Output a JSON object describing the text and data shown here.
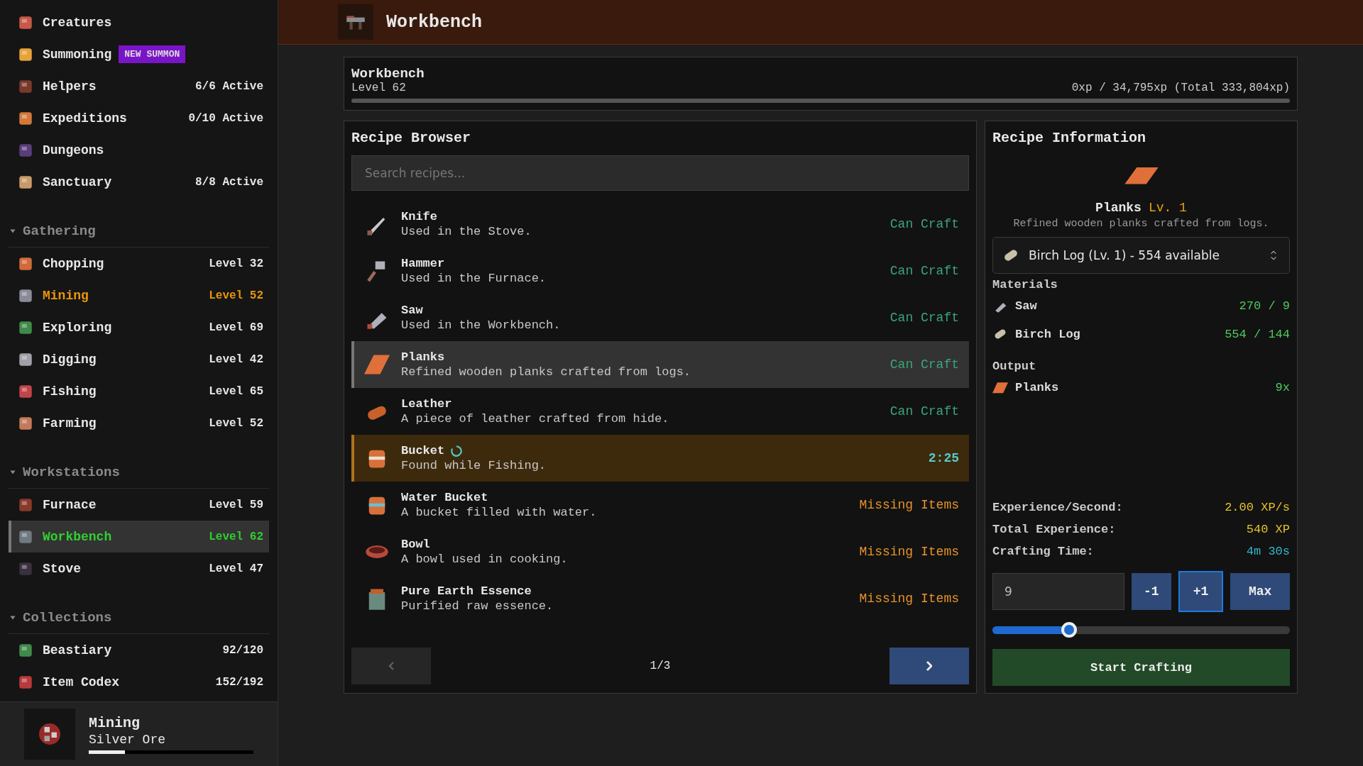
{
  "sidebar": {
    "top_items": [
      {
        "name": "Creatures"
      },
      {
        "name": "Summoning",
        "badge": "NEW SUMMON"
      },
      {
        "name": "Helpers",
        "status": "6/6 Active"
      },
      {
        "name": "Expeditions",
        "status": "0/10 Active"
      },
      {
        "name": "Dungeons"
      },
      {
        "name": "Sanctuary",
        "status": "8/8 Active"
      }
    ],
    "sections": [
      {
        "title": "Gathering",
        "expanded": true,
        "items": [
          {
            "name": "Chopping",
            "status": "Level 32",
            "active": false,
            "selected": false
          },
          {
            "name": "Mining",
            "status": "Level 52",
            "active": true,
            "selected": false
          },
          {
            "name": "Exploring",
            "status": "Level 69",
            "active": false,
            "selected": false
          },
          {
            "name": "Digging",
            "status": "Level 42",
            "active": false,
            "selected": false
          },
          {
            "name": "Fishing",
            "status": "Level 65",
            "active": false,
            "selected": false
          },
          {
            "name": "Farming",
            "status": "Level 52",
            "active": false,
            "selected": false
          }
        ]
      },
      {
        "title": "Workstations",
        "expanded": true,
        "items": [
          {
            "name": "Furnace",
            "status": "Level 59",
            "active": false,
            "selected": false
          },
          {
            "name": "Workbench",
            "status": "Level 62",
            "active": false,
            "selected": true
          },
          {
            "name": "Stove",
            "status": "Level 47",
            "active": false,
            "selected": false
          }
        ]
      },
      {
        "title": "Collections",
        "expanded": true,
        "items": [
          {
            "name": "Beastiary",
            "status": "92/120",
            "active": false,
            "selected": false
          },
          {
            "name": "Item Codex",
            "status": "152/192",
            "active": false,
            "selected": false
          }
        ]
      }
    ],
    "current_activity": {
      "title": "Mining",
      "subtitle": "Silver Ore",
      "level": 0.22
    }
  },
  "header": {
    "title": "Workbench"
  },
  "skill": {
    "name": "Workbench",
    "level_text": "Level 62",
    "xp": "0xp / 34,795xp (Total 333,804xp)",
    "level": 0
  },
  "recipe_browser": {
    "title": "Recipe Browser",
    "search": {
      "placeholder": "Search recipes..."
    },
    "recipes": [
      {
        "name": "Knife",
        "description": "Used in the Stove.",
        "kind": "can_craft",
        "status": "Can Craft",
        "selected": false
      },
      {
        "name": "Hammer",
        "description": "Used in the Furnace.",
        "kind": "can_craft",
        "status": "Can Craft",
        "selected": false
      },
      {
        "name": "Saw",
        "description": "Used in the Workbench.",
        "kind": "can_craft",
        "status": "Can Craft",
        "selected": false
      },
      {
        "name": "Planks",
        "description": "Refined wooden planks crafted from logs.",
        "kind": "can_craft",
        "status": "Can Craft",
        "selected": true
      },
      {
        "name": "Leather",
        "description": "A piece of leather crafted from hide.",
        "kind": "can_craft",
        "status": "Can Craft",
        "selected": false
      },
      {
        "name": "Bucket",
        "description": "Found while Fishing.",
        "kind": "in_progress",
        "status": "2:25",
        "selected": false
      },
      {
        "name": "Water Bucket",
        "description": "A bucket filled with water.",
        "kind": "missing",
        "status": "Missing Items",
        "selected": false
      },
      {
        "name": "Bowl",
        "description": "A bowl used in cooking.",
        "kind": "missing",
        "status": "Missing Items",
        "selected": false
      },
      {
        "name": "Pure Earth Essence",
        "description": "Purified raw essence.",
        "kind": "missing",
        "status": "Missing Items",
        "selected": false
      }
    ],
    "pagination": {
      "page": "1/3",
      "prev_disabled": true,
      "next_disabled": false
    }
  },
  "recipe_info": {
    "title": "Recipe Information",
    "item_name": "Planks",
    "item_level": "Lv. 1",
    "description": "Refined wooden planks crafted from logs.",
    "material_select": {
      "value": "Birch Log (Lv. 1) - 554 available"
    },
    "materials_title": "Materials",
    "materials": [
      {
        "name": "Saw",
        "count": "270 / 9"
      },
      {
        "name": "Birch Log",
        "count": "554 / 144"
      }
    ],
    "output_title": "Output",
    "output": {
      "name": "Planks",
      "count": "9x"
    },
    "stats": [
      {
        "label": "Experience/Second:",
        "value": "2.00 XP/s",
        "kind": "xp"
      },
      {
        "label": "Total Experience:",
        "value": "540 XP",
        "kind": "xp"
      },
      {
        "label": "Crafting Time:",
        "value": "4m 30s",
        "kind": "time"
      }
    ],
    "quantity": {
      "value": "9"
    },
    "quantity_buttons": [
      {
        "label": "-1",
        "selected": false
      },
      {
        "label": "+1",
        "selected": true
      },
      {
        "label": "Max",
        "selected": false
      }
    ],
    "quantity_slider": {
      "level": 0.257
    },
    "start_button": "Start Crafting"
  }
}
